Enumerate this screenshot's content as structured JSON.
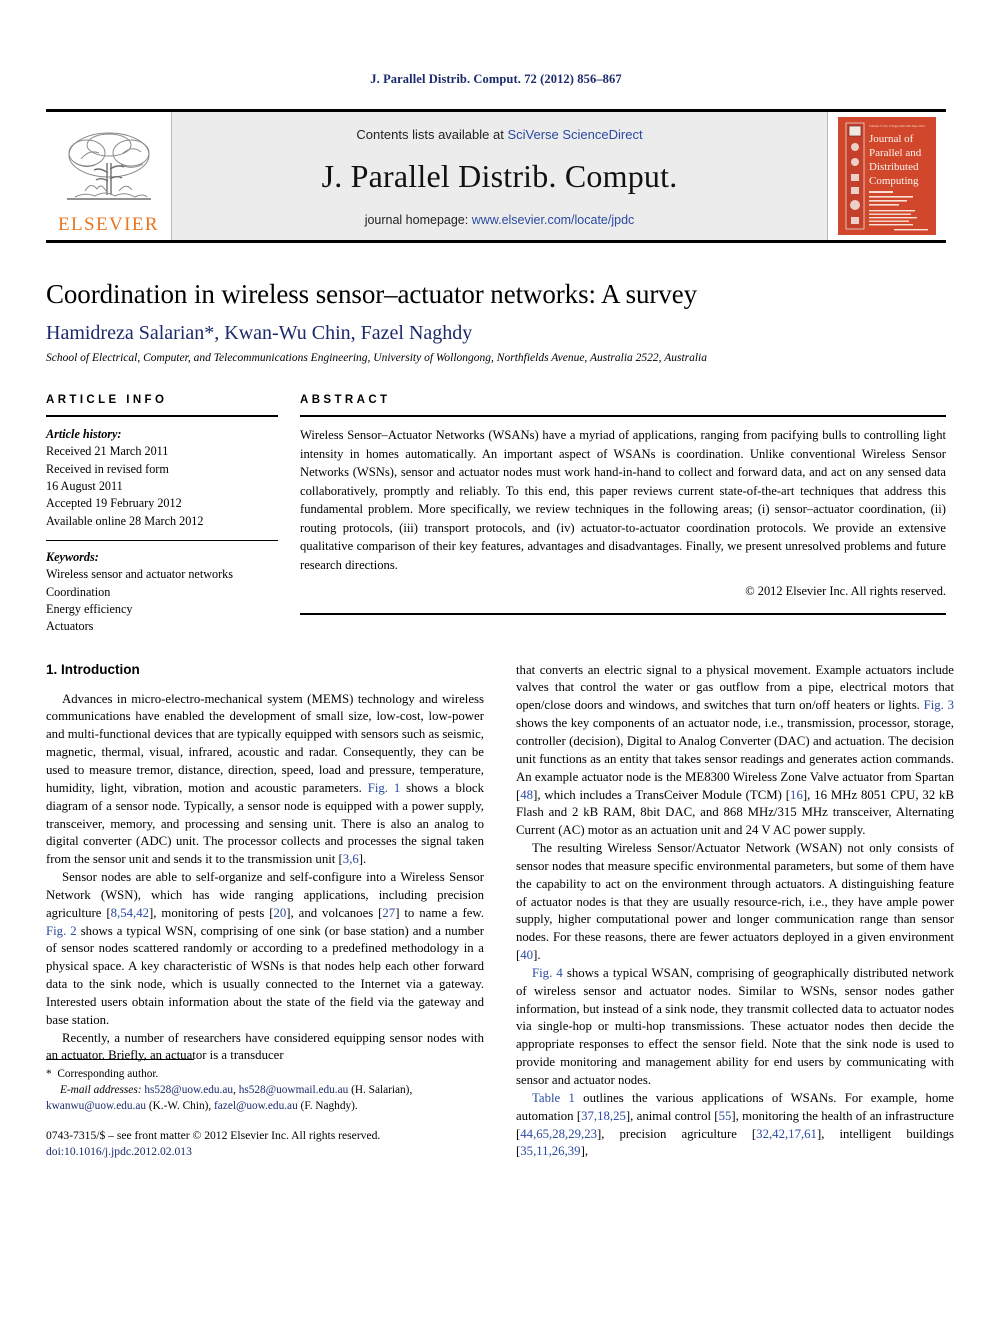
{
  "running_head": "J. Parallel Distrib. Comput. 72 (2012) 856–867",
  "masthead": {
    "publisher_name": "ELSEVIER",
    "contents_prefix": "Contents lists available at ",
    "contents_link": "SciVerse ScienceDirect",
    "journal_title": "J. Parallel Distrib. Comput.",
    "homepage_prefix": "journal homepage: ",
    "homepage_link": "www.elsevier.com/locate/jpdc",
    "cover": {
      "line1": "Journal of",
      "line2": "Parallel and",
      "line3": "Distributed",
      "line4": "Computing",
      "bg_color": "#D0472B"
    }
  },
  "title_block": {
    "title": "Coordination in wireless sensor–actuator networks: A survey",
    "authors": "Hamidreza Salarian*, Kwan-Wu Chin, Fazel Naghdy",
    "affiliation": "School of Electrical, Computer, and Telecommunications Engineering, University of Wollongong, Northfields Avenue, Australia 2522, Australia"
  },
  "article_info": {
    "heading": "ARTICLE INFO",
    "history_label": "Article history:",
    "history": [
      "Received 21 March 2011",
      "Received in revised form",
      "16 August 2011",
      "Accepted 19 February 2012",
      "Available online 28 March 2012"
    ],
    "keywords_label": "Keywords:",
    "keywords": [
      "Wireless sensor and actuator networks",
      "Coordination",
      "Energy efficiency",
      "Actuators"
    ]
  },
  "abstract": {
    "heading": "ABSTRACT",
    "text": "Wireless Sensor–Actuator Networks (WSANs) have a myriad of applications, ranging from pacifying bulls to controlling light intensity in homes automatically. An important aspect of WSANs is coordination. Unlike conventional Wireless Sensor Networks (WSNs), sensor and actuator nodes must work hand-in-hand to collect and forward data, and act on any sensed data collaboratively, promptly and reliably. To this end, this paper reviews current state-of-the-art techniques that address this fundamental problem. More specifically, we review techniques in the following areas; (i) sensor–actuator coordination, (ii) routing protocols, (iii) transport protocols, and (iv) actuator-to-actuator coordination protocols. We provide an extensive qualitative comparison of their key features, advantages and disadvantages. Finally, we present unresolved problems and future research directions.",
    "copyright": "© 2012 Elsevier Inc. All rights reserved."
  },
  "body": {
    "section_title": "1. Introduction",
    "left_paragraphs": [
      "Advances in micro-electro-mechanical system (MEMS) technology and wireless communications have enabled the development of small size, low-cost, low-power and multi-functional devices that are typically equipped with sensors such as seismic, magnetic, thermal, visual, infrared, acoustic and radar. Consequently, they can be used to measure tremor, distance, direction, speed, load and pressure, temperature, humidity, light, vibration, motion and acoustic parameters. §Fig. 1§ shows a block diagram of a sensor node. Typically, a sensor node is equipped with a power supply, transceiver, memory, and processing and sensing unit. There is also an analog to digital converter (ADC) unit. The processor collects and processes the signal taken from the sensor unit and sends it to the transmission unit [§3,6§].",
      "Sensor nodes are able to self-organize and self-configure into a Wireless Sensor Network (WSN), which has wide ranging applications, including precision agriculture [§8,54,42§], monitoring of pests [§20§], and volcanoes [§27§] to name a few. §Fig. 2§ shows a typical WSN, comprising of one sink (or base station) and a number of sensor nodes scattered randomly or according to a predefined methodology in a physical space. A key characteristic of WSNs is that nodes help each other forward data to the sink node, which is usually connected to the Internet via a gateway. Interested users obtain information about the state of the field via the gateway and base station.",
      "Recently, a number of researchers have considered equipping sensor nodes with an actuator. Briefly, an actuator is a transducer"
    ],
    "right_paragraphs": [
      "that converts an electric signal to a physical movement. Example actuators include valves that control the water or gas outflow from a pipe, electrical motors that open/close doors and windows, and switches that turn on/off heaters or lights. §Fig. 3§ shows the key components of an actuator node, i.e., transmission, processor, storage, controller (decision), Digital to Analog Converter (DAC) and actuation. The decision unit functions as an entity that takes sensor readings and generates action commands. An example actuator node is the ME8300 Wireless Zone Valve actuator from Spartan [§48§], which includes a TransCeiver Module (TCM) [§16§], 16 MHz 8051 CPU, 32 kB Flash and 2 kB RAM, 8bit DAC, and 868 MHz/315 MHz transceiver, Alternating Current (AC) motor as an actuation unit and 24 V AC power supply.",
      "The resulting Wireless Sensor/Actuator Network (WSAN) not only consists of sensor nodes that measure specific environmental parameters, but some of them have the capability to act on the environment through actuators. A distinguishing feature of actuator nodes is that they are usually resource-rich, i.e., they have ample power supply, higher computational power and longer communication range than sensor nodes. For these reasons, there are fewer actuators deployed in a given environment [§40§].",
      "§Fig. 4§ shows a typical WSAN, comprising of geographically distributed network of wireless sensor and actuator nodes. Similar to WSNs, sensor nodes gather information, but instead of a sink node, they transmit collected data to actuator nodes via single-hop or multi-hop transmissions. These actuator nodes then decide the appropriate responses to effect the sensor field. Note that the sink node is used to provide monitoring and management ability for end users by communicating with sensor and actuator nodes.",
      "§Table 1§ outlines the various applications of WSANs. For example, home automation [§37,18,25§], animal control [§55§], monitoring the health of an infrastructure [§44,65,28,29,23§], precision agriculture [§32,42,17,61§], intelligent buildings [§35,11,26,39§],"
    ]
  },
  "footnotes": {
    "corresponding_marker": "*",
    "corresponding_text": "Corresponding author.",
    "email_label": "E-mail addresses:",
    "emails": "§hs528@uow.edu.au§, §hs528@uowmail.edu.au§ (H. Salarian), §kwanwu@uow.edu.au§ (K.-W. Chin), §fazel@uow.edu.au§ (F. Naghdy).",
    "issn_line": "0743-7315/$ – see front matter © 2012 Elsevier Inc. All rights reserved.",
    "doi_line": "doi:10.1016/j.jpdc.2012.02.013"
  }
}
